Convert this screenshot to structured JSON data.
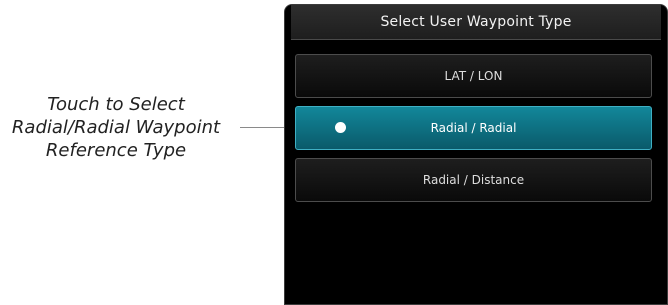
{
  "callout": {
    "line1": "Touch to Select",
    "line2": "Radial/Radial Waypoint",
    "line3": "Reference Type"
  },
  "dialog": {
    "title": "Select User Waypoint Type",
    "options": [
      {
        "label": "LAT / LON",
        "selected": false
      },
      {
        "label": "Radial / Radial",
        "selected": true
      },
      {
        "label": "Radial / Distance",
        "selected": false
      }
    ]
  },
  "colors": {
    "selected_fill": "#0f7a8c",
    "button_fill": "#141414",
    "panel_bg": "#000000",
    "leader_line": "#8a8a8a"
  }
}
